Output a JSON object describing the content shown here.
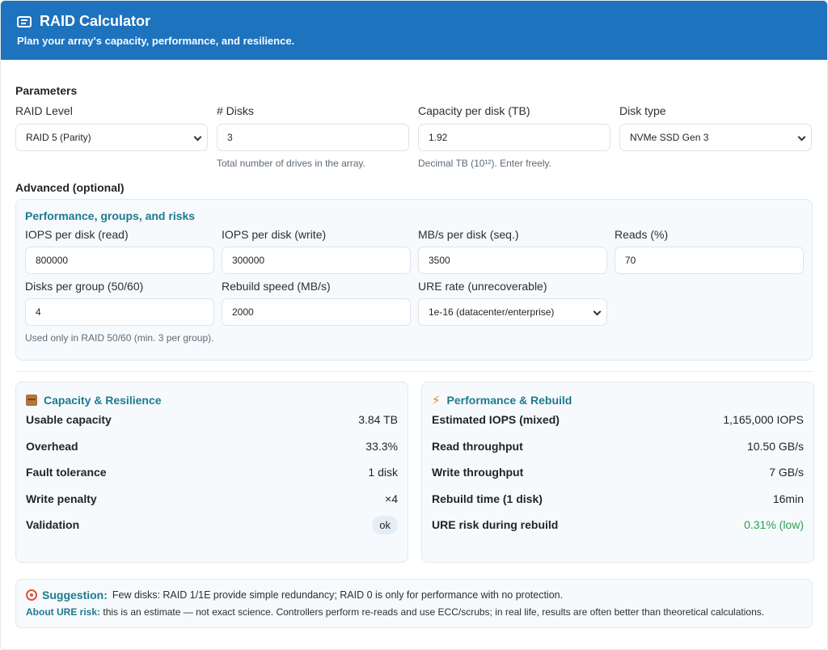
{
  "header": {
    "title": "RAID Calculator",
    "subtitle": "Plan your array's capacity, performance, and resilience."
  },
  "params": {
    "title": "Parameters",
    "raid_level": {
      "label": "RAID Level",
      "value": "RAID 5 (Parity)"
    },
    "disks": {
      "label": "# Disks",
      "value": "3",
      "hint": "Total number of drives in the array."
    },
    "capacity": {
      "label": "Capacity per disk (TB)",
      "value": "1.92",
      "hint": "Decimal TB (10¹²). Enter freely."
    },
    "disk_type": {
      "label": "Disk type",
      "value": "NVMe SSD Gen 3"
    }
  },
  "advanced": {
    "title": "Advanced (optional)",
    "subtitle": "Performance, groups, and risks",
    "iops_read": {
      "label": "IOPS per disk (read)",
      "value": "800000"
    },
    "iops_write": {
      "label": "IOPS per disk (write)",
      "value": "300000"
    },
    "mbs": {
      "label": "MB/s per disk (seq.)",
      "value": "3500"
    },
    "reads": {
      "label": "Reads (%)",
      "value": "70"
    },
    "group": {
      "label": "Disks per group (50/60)",
      "value": "4",
      "hint": "Used only in RAID 50/60 (min. 3 per group)."
    },
    "rebuild_speed": {
      "label": "Rebuild speed (MB/s)",
      "value": "2000"
    },
    "ure": {
      "label": "URE rate (unrecoverable)",
      "value": "1e-16 (datacenter/enterprise)"
    }
  },
  "capacity_card": {
    "title": "Capacity & Resilience",
    "icon": "box-icon",
    "rows": [
      {
        "key": "Usable capacity",
        "value": "3.84 TB"
      },
      {
        "key": "Overhead",
        "value": "33.3%"
      },
      {
        "key": "Fault tolerance",
        "value": "1 disk"
      },
      {
        "key": "Write penalty",
        "value": "×4"
      }
    ],
    "validation": {
      "key": "Validation",
      "value": "ok"
    }
  },
  "perf_card": {
    "title": "Performance & Rebuild",
    "icon": "bolt-icon",
    "rows": [
      {
        "key": "Estimated IOPS (mixed)",
        "value": "1,165,000 IOPS"
      },
      {
        "key": "Read throughput",
        "value": "10.50 GB/s"
      },
      {
        "key": "Write throughput",
        "value": "7 GB/s"
      },
      {
        "key": "Rebuild time (1 disk)",
        "value": "16min"
      },
      {
        "key": "URE risk during rebuild",
        "value": "0.31% (low)"
      }
    ],
    "good_color": "#2e9e4f"
  },
  "suggestion": {
    "label": "Suggestion:",
    "text": "Few disks: RAID 1/1E provide simple redundancy; RAID 0 is only for performance with no protection.",
    "ure_label": "About URE risk:",
    "ure_text": "this is an estimate — not exact science. Controllers perform re-reads and use ECC/scrubs; in real life, results are often better than theoretical calculations."
  },
  "colors": {
    "header_bg": "#1e73be",
    "accent": "#1d7a8f"
  }
}
